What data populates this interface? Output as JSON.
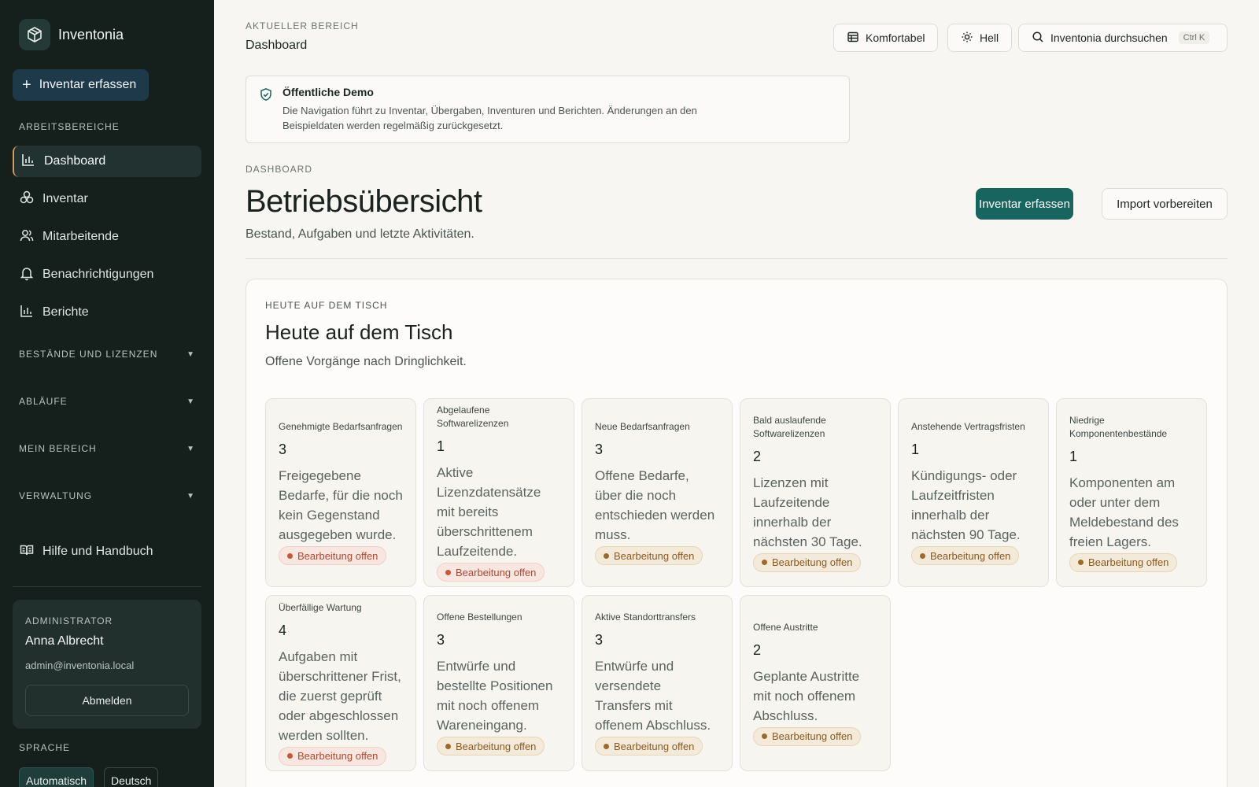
{
  "app": {
    "name": "Inventonia"
  },
  "sidebar": {
    "primary_action": "Inventar erfassen",
    "section_label": "ARBEITSBEREICHE",
    "nav": [
      {
        "label": "Dashboard",
        "icon": "bar-chart-icon",
        "active": true
      },
      {
        "label": "Inventar",
        "icon": "boxes-icon"
      },
      {
        "label": "Mitarbeitende",
        "icon": "users-icon"
      },
      {
        "label": "Benachrichtigungen",
        "icon": "bell-icon"
      },
      {
        "label": "Berichte",
        "icon": "bar-chart-icon"
      }
    ],
    "groups": [
      "BESTÄNDE UND LIZENZEN",
      "ABLÄUFE",
      "MEIN BEREICH",
      "VERWALTUNG"
    ],
    "help": "Hilfe und Handbuch",
    "user": {
      "role": "ADMINISTRATOR",
      "name": "Anna Albrecht",
      "email": "admin@inventonia.local",
      "logout": "Abmelden"
    },
    "language": {
      "label": "SPRACHE",
      "options": [
        "Automatisch",
        "Deutsch"
      ],
      "selected": "Automatisch"
    }
  },
  "topbar": {
    "area_label": "AKTUELLER BEREICH",
    "area_title": "Dashboard",
    "density": "Komfortabel",
    "theme": "Hell",
    "search": "Inventonia durchsuchen",
    "search_shortcut": "Ctrl K"
  },
  "demo_notice": {
    "title": "Öffentliche Demo",
    "text": "Die Navigation führt zu Inventar, Übergaben, Inventuren und Berichten. Änderungen an den Beispieldaten werden regelmäßig zurückgesetzt."
  },
  "page": {
    "kicker": "DASHBOARD",
    "title": "Betriebsübersicht",
    "subtitle": "Bestand, Aufgaben und letzte Aktivitäten.",
    "primary_button": "Inventar erfassen",
    "secondary_button": "Import vorbereiten"
  },
  "panel": {
    "kicker": "HEUTE AUF DEM TISCH",
    "title": "Heute auf dem Tisch",
    "subtitle": "Offene Vorgänge nach Dringlichkeit.",
    "status_colors": {
      "red": "#c4573c",
      "amber": "#9a6a2a"
    },
    "cards": [
      {
        "label": "Genehmigte Bedarfsanfragen",
        "value": "3",
        "desc": "Freigegebene Bedarfe, für die noch kein Gegenstand ausgegeben wurde.",
        "status": "Bearbeitung offen",
        "tone": "red"
      },
      {
        "label": "Abgelaufene Softwarelizenzen",
        "value": "1",
        "desc": "Aktive Lizenzdatensätze mit bereits überschrittenem Laufzeitende.",
        "status": "Bearbeitung offen",
        "tone": "red"
      },
      {
        "label": "Neue Bedarfsanfragen",
        "value": "3",
        "desc": "Offene Bedarfe, über die noch entschieden werden muss.",
        "status": "Bearbeitung offen",
        "tone": "amber"
      },
      {
        "label": "Bald auslaufende Softwarelizenzen",
        "value": "2",
        "desc": "Lizenzen mit Laufzeitende innerhalb der nächsten 30 Tage.",
        "status": "Bearbeitung offen",
        "tone": "amber"
      },
      {
        "label": "Anstehende Vertragsfristen",
        "value": "1",
        "desc": "Kündigungs- oder Laufzeitfristen innerhalb der nächsten 90 Tage.",
        "status": "Bearbeitung offen",
        "tone": "amber"
      },
      {
        "label": "Niedrige Komponentenbestände",
        "value": "1",
        "desc": "Komponenten am oder unter dem Meldebestand des freien Lagers.",
        "status": "Bearbeitung offen",
        "tone": "amber"
      },
      {
        "label": "Überfällige Wartung",
        "value": "4",
        "desc": "Aufgaben mit überschrittener Frist, die zuerst geprüft oder abgeschlossen werden sollten.",
        "status": "Bearbeitung offen",
        "tone": "red"
      },
      {
        "label": "Offene Bestellungen",
        "value": "3",
        "desc": "Entwürfe und bestellte Positionen mit noch offenem Wareneingang.",
        "status": "Bearbeitung offen",
        "tone": "amber"
      },
      {
        "label": "Aktive Standorttransfers",
        "value": "3",
        "desc": "Entwürfe und versendete Transfers mit offenem Abschluss.",
        "status": "Bearbeitung offen",
        "tone": "amber"
      },
      {
        "label": "Offene Austritte",
        "value": "2",
        "desc": "Geplante Austritte mit noch offenem Abschluss.",
        "status": "Bearbeitung offen",
        "tone": "amber"
      }
    ]
  }
}
